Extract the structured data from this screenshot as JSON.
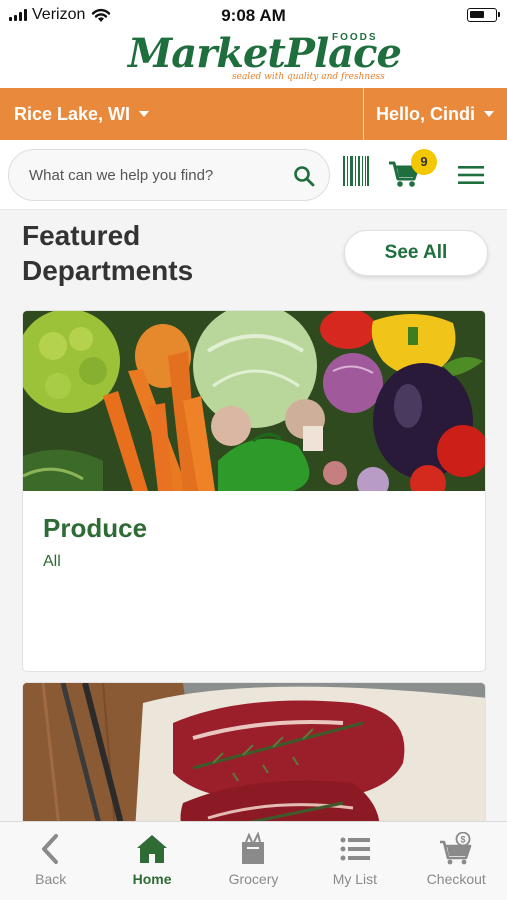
{
  "status_bar": {
    "carrier": "Verizon",
    "time": "9:08 AM",
    "battery_level": 0.6
  },
  "brand": {
    "name": "MarketPlace",
    "foods": "FOODS",
    "tagline": "sealed with quality and freshness",
    "colors": {
      "green": "#1f6e3d",
      "orange": "#e9893b",
      "badge_yellow": "#f4c800"
    }
  },
  "location_bar": {
    "store": "Rice Lake, WI",
    "greeting": "Hello, Cindi"
  },
  "search": {
    "placeholder": "What can we help you find?",
    "value": ""
  },
  "cart": {
    "count": "9"
  },
  "featured": {
    "title": "Featured Departments",
    "see_all_label": "See All"
  },
  "departments": [
    {
      "title": "Produce",
      "subtitle": "All"
    },
    {
      "title": "",
      "subtitle": ""
    }
  ],
  "bottom_nav": {
    "items": [
      {
        "label": "Back",
        "icon": "back-chevron-icon"
      },
      {
        "label": "Home",
        "icon": "home-icon",
        "active": true
      },
      {
        "label": "Grocery",
        "icon": "grocery-bag-icon"
      },
      {
        "label": "My List",
        "icon": "list-icon"
      },
      {
        "label": "Checkout",
        "icon": "checkout-cart-icon"
      }
    ]
  }
}
